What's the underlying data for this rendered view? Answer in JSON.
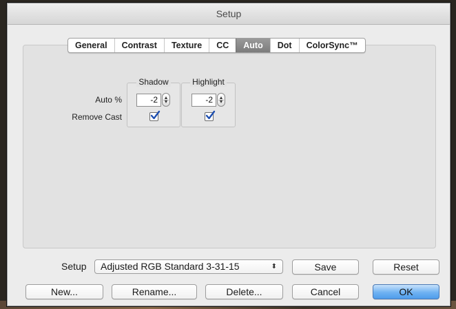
{
  "window": {
    "title": "Setup"
  },
  "tabs": [
    {
      "label": "General",
      "active": false
    },
    {
      "label": "Contrast",
      "active": false
    },
    {
      "label": "Texture",
      "active": false
    },
    {
      "label": "CC",
      "active": false
    },
    {
      "label": "Auto",
      "active": true
    },
    {
      "label": "Dot",
      "active": false
    },
    {
      "label": "ColorSync™",
      "active": false
    }
  ],
  "auto": {
    "row_auto_label": "Auto %",
    "row_cast_label": "Remove Cast",
    "shadow": {
      "title": "Shadow",
      "value": "-2",
      "remove_cast": true
    },
    "highlight": {
      "title": "Highlight",
      "value": "-2",
      "remove_cast": true
    }
  },
  "footer": {
    "setup_label": "Setup",
    "setup_selected": "Adjusted RGB Standard 3-31-15",
    "popup_icon": "up-down-arrows-icon",
    "save": "Save",
    "reset": "Reset",
    "new": "New...",
    "rename": "Rename...",
    "delete": "Delete...",
    "cancel": "Cancel",
    "ok": "OK"
  },
  "colors": {
    "window_bg": "#ececec",
    "active_tab": "#7c7c7c",
    "default_button": "#6fb2f2"
  }
}
